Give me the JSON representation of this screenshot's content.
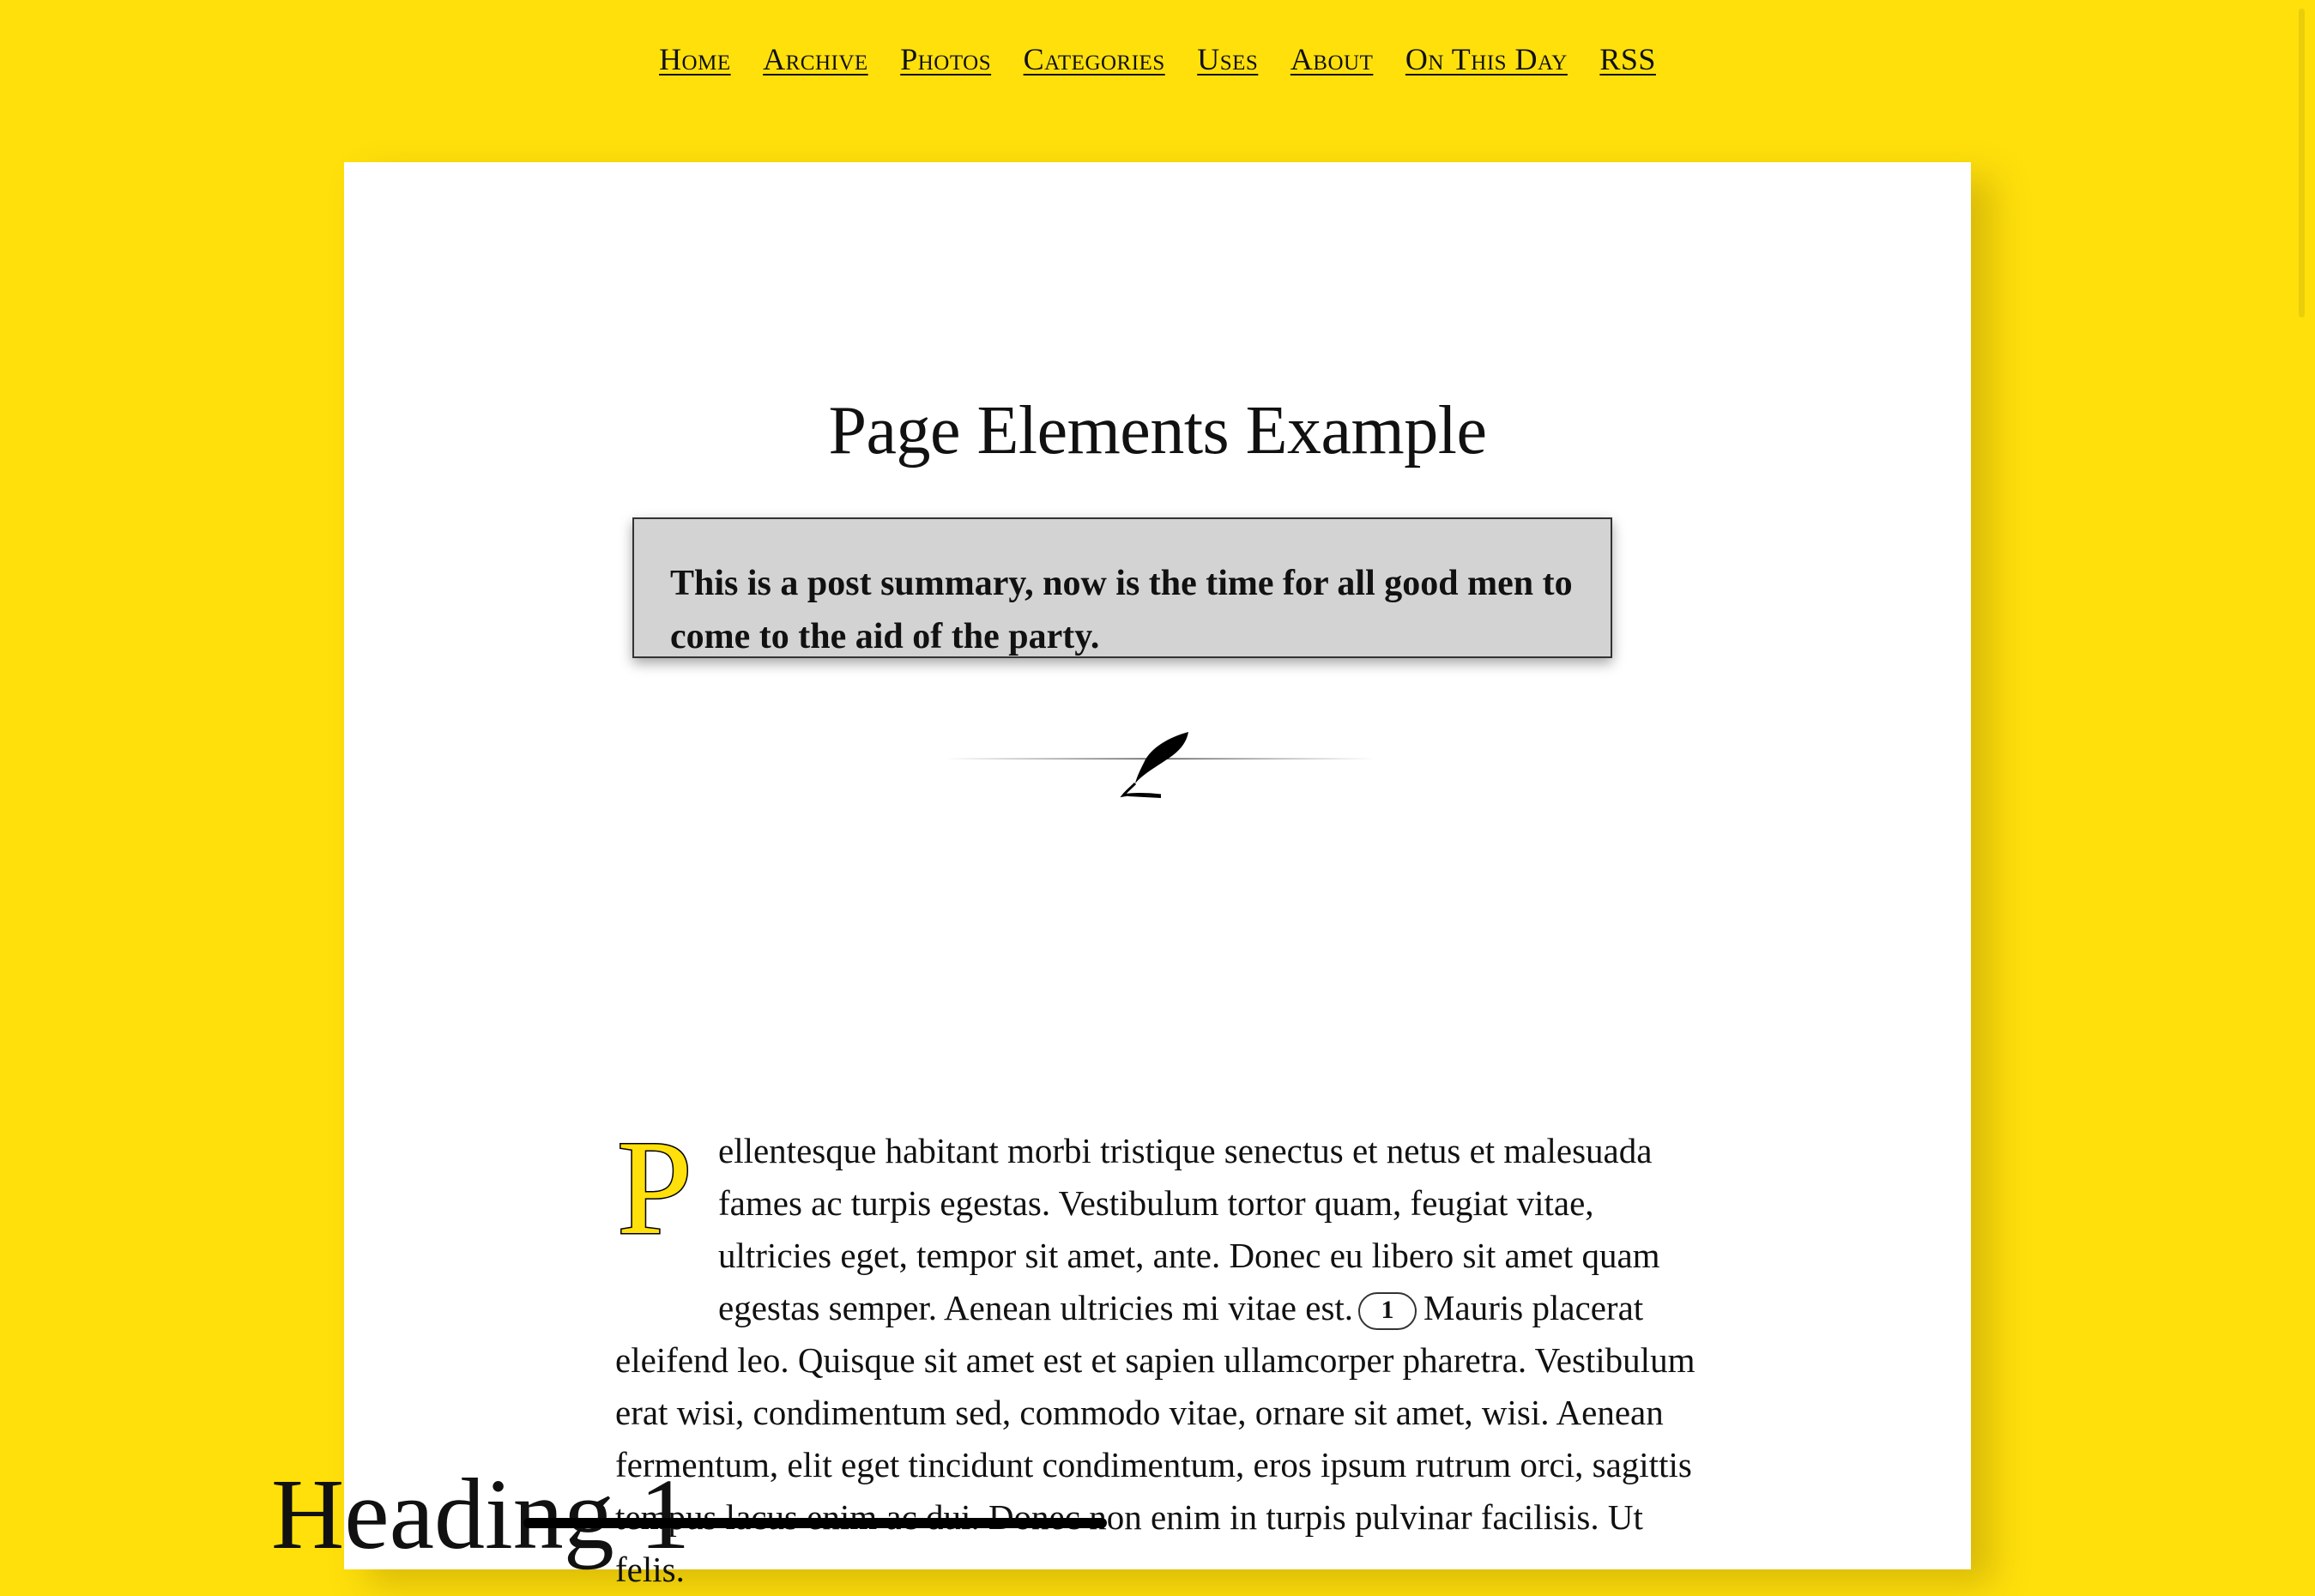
{
  "nav": {
    "items": [
      {
        "label": "Home"
      },
      {
        "label": "Archive"
      },
      {
        "label": "Photos"
      },
      {
        "label": "Categories"
      },
      {
        "label": "Uses"
      },
      {
        "label": "About"
      },
      {
        "label": "On This Day"
      },
      {
        "label": "RSS"
      }
    ]
  },
  "post": {
    "title": "Page Elements Example",
    "summary": "This is a post summary, now is the time for all good men to come to the aid of the party.",
    "divider_icon": "quill-icon",
    "dropcap_letter": "P",
    "body_part1": "ellentesque habitant morbi tristique senectus et netus et malesuada fames ac turpis egestas. Vestibulum tortor quam, feugiat vitae, ultricies eget, tempor sit amet, ante. Donec eu libero sit amet quam egestas semper. Aenean ultricies mi vitae est.",
    "footnote_ref": "1",
    "body_part2": "Mauris placerat eleifend leo. Quisque sit amet est et sapien ullamcorper pharetra. Vestibulum erat wisi, condimentum sed, commodo vitae, ornare sit amet, wisi. Aenean fermentum, elit eget tincidunt condimentum, eros ipsum rutrum orci, sagittis tempus lacus enim ac dui. Donec non enim in turpis pulvinar facilisis. Ut felis.",
    "heading1": "Heading 1"
  },
  "colors": {
    "background": "#ffe00b",
    "card": "#ffffff",
    "summary_box": "#d3d3d3",
    "dropcap_fill": "#ffe00b"
  }
}
